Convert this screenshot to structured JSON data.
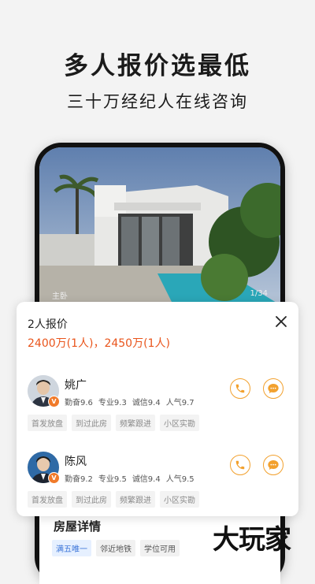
{
  "promo": {
    "headline": "多人报价选最低",
    "subline": "三十万经纪人在线咨询"
  },
  "listing": {
    "photo_label": "主卧",
    "photo_counter": "1/34",
    "details_title": "房屋详情",
    "chips": [
      "满五唯一",
      "邻近地铁",
      "学位可用"
    ]
  },
  "quote_panel": {
    "title": "2人报价",
    "prices": "2400万(1人)，2450万(1人)",
    "agents": [
      {
        "name": "姚广",
        "badge": "V",
        "stats": [
          "勤奋9.6",
          "专业9.3",
          "诚信9.4",
          "人气9.7"
        ],
        "tags": [
          "首发放盘",
          "到过此房",
          "频繁跟进",
          "小区实勘"
        ]
      },
      {
        "name": "陈风",
        "badge": "V",
        "stats": [
          "勤奋9.2",
          "专业9.5",
          "诚信9.4",
          "人气9.5"
        ],
        "tags": [
          "首发放盘",
          "到过此房",
          "频繁跟进",
          "小区实勘"
        ]
      }
    ]
  },
  "watermark": "大玩家",
  "colors": {
    "accent": "#e9541b",
    "icon_ring": "#f2a12e",
    "badge": "#f07a2a"
  }
}
